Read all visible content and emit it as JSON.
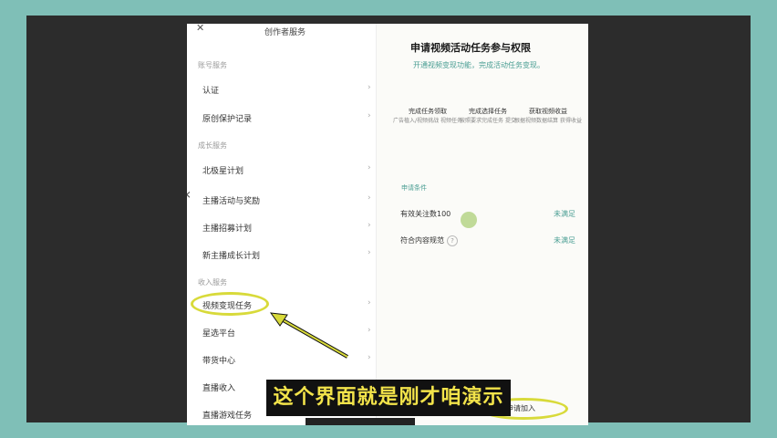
{
  "sidebar": {
    "title": "创作者服务",
    "sections": [
      {
        "label": "账号服务",
        "items": [
          "认证",
          "原创保护记录"
        ]
      },
      {
        "label": "成长服务",
        "items": [
          "北极星计划",
          "主播活动与奖励",
          "主播招募计划",
          "新主播成长计划"
        ]
      },
      {
        "label": "收入服务",
        "items": [
          "视频变现任务",
          "星选平台",
          "带货中心",
          "直播收入",
          "直播游戏任务"
        ]
      }
    ]
  },
  "main": {
    "title": "申请视频活动任务参与权限",
    "subtitle": "开通视频变现功能，完成活动任务变现。",
    "steps": [
      {
        "title": "完成任务领取",
        "desc": "广告植入/视频挑战\n视频任务"
      },
      {
        "title": "完成选择任务",
        "desc": "按照要求完成任务\n提交"
      },
      {
        "title": "获取视频收益",
        "desc": "根据视频数据结算\n获得收益"
      }
    ],
    "requirements_label": "申请条件",
    "requirements": [
      {
        "name": "有效关注数100",
        "status": "未满足"
      },
      {
        "name": "符合内容规范",
        "status": "未满足"
      }
    ],
    "apply_button": "申请加入"
  },
  "caption": "这个界面就是刚才咱演示",
  "colors": {
    "accent": "#4a9e93",
    "highlight": "#d8da3a",
    "caption_text": "#f2e34a"
  }
}
